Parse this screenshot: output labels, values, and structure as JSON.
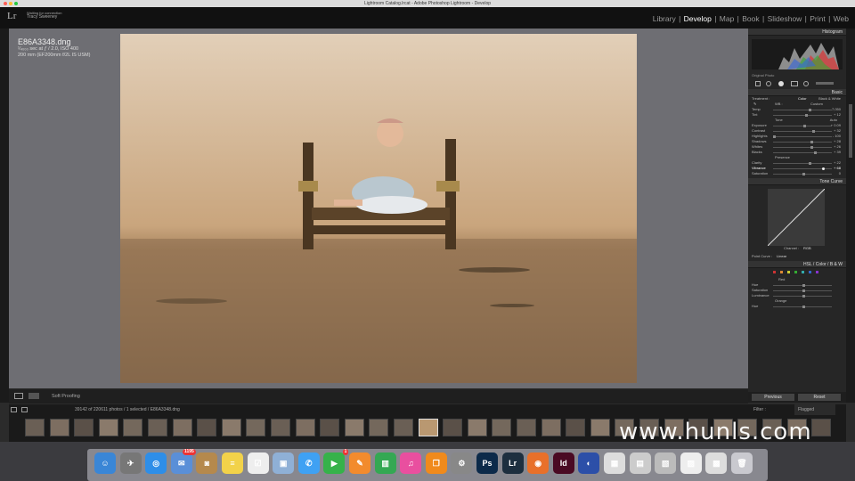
{
  "window": {
    "title": "Lightroom Catalog.lrcat - Adobe Photoshop Lightroom - Develop"
  },
  "header": {
    "logo": "Lr",
    "owner_line1": "Waiting for connection",
    "owner_line2": "Tracy Sweeney"
  },
  "modules": [
    {
      "label": "Library"
    },
    {
      "label": "Develop"
    },
    {
      "label": "Map"
    },
    {
      "label": "Book"
    },
    {
      "label": "Slideshow"
    },
    {
      "label": "Print"
    },
    {
      "label": "Web"
    }
  ],
  "active_module": "Develop",
  "photo_info": {
    "filename": "E86A3348.dng",
    "exposure": "¹⁄₄₀₀₀ sec at ƒ / 2.0, ISO 400",
    "lens": "200 mm (EF200mm f/2L IS USM)"
  },
  "toolbar": {
    "soft_proofing": "Soft Proofing"
  },
  "panel": {
    "histogram_title": "Histogram",
    "original_photo": "Original Photo",
    "basic_title": "Basic",
    "treatment_label": "Treatment :",
    "treatment_color": "Color",
    "treatment_bw": "Black & White",
    "wb_label": "WB :",
    "wb_value": "Custom",
    "tone_label": "Tone",
    "tone_auto": "Auto",
    "presence_label": "Presence",
    "tone_curve_title": "Tone Curve",
    "channel_label": "Channel :",
    "channel_value": "RGB",
    "point_curve_label": "Point Curve :",
    "point_curve_value": "Linear",
    "hsl_tabs": "HSL  /  Color  /  B & W",
    "red_label": "Red",
    "orange_label": "Orange",
    "previous_button": "Previous",
    "reset_button": "Reset",
    "sliders": [
      {
        "label": "Temp",
        "value": "7,050"
      },
      {
        "label": "Tint",
        "value": "+ 12"
      },
      {
        "label": "Exposure",
        "value": "+ 0.09"
      },
      {
        "label": "Contrast",
        "value": "+ 32"
      },
      {
        "label": "Highlights",
        "value": "- 100"
      },
      {
        "label": "Shadows",
        "value": "+ 28"
      },
      {
        "label": "Whites",
        "value": "+ 26"
      },
      {
        "label": "Blacks",
        "value": "+ 39"
      },
      {
        "label": "Clarity",
        "value": "+ 22"
      },
      {
        "label": "Vibrance",
        "value": "+ 68"
      },
      {
        "label": "Saturation",
        "value": "0"
      }
    ],
    "hsl_sliders": [
      {
        "label": "Hue"
      },
      {
        "label": "Saturation"
      },
      {
        "label": "Luminance"
      },
      {
        "label": "Hue"
      }
    ]
  },
  "filmbar": {
    "info": "39142 of 220611 photos / 1 selected / E86A3348.dng",
    "filter_label": "Filter :",
    "filter_value": "Flagged"
  },
  "watermark": "www.hunls.com",
  "dock": [
    {
      "name": "finder-icon",
      "color": "#3a86d6",
      "glyph": "☺"
    },
    {
      "name": "launchpad-icon",
      "color": "#777",
      "glyph": "✈"
    },
    {
      "name": "safari-icon",
      "color": "#2e8ee8",
      "glyph": "◎"
    },
    {
      "name": "mail-icon",
      "color": "#5a8fd8",
      "glyph": "✉",
      "badge": "1195"
    },
    {
      "name": "contacts-icon",
      "color": "#b5894d",
      "glyph": "◙"
    },
    {
      "name": "notes-icon",
      "color": "#f2d24a",
      "glyph": "≡"
    },
    {
      "name": "reminders-icon",
      "color": "#eee",
      "glyph": "☑"
    },
    {
      "name": "preview-icon",
      "color": "#8fb0d6",
      "glyph": "▣"
    },
    {
      "name": "messages-icon",
      "color": "#3fa1f3",
      "glyph": "✆"
    },
    {
      "name": "facetime-icon",
      "color": "#36b24a",
      "glyph": "▶",
      "badge": "1"
    },
    {
      "name": "pages-icon",
      "color": "#f28b2d",
      "glyph": "✎"
    },
    {
      "name": "numbers-icon",
      "color": "#34a853",
      "glyph": "▥"
    },
    {
      "name": "itunes-icon",
      "color": "#e94f9f",
      "glyph": "♫"
    },
    {
      "name": "ibooks-icon",
      "color": "#f08a1c",
      "glyph": "❒"
    },
    {
      "name": "system-preferences-icon",
      "color": "#888",
      "glyph": "⚙"
    },
    {
      "name": "photoshop-icon",
      "color": "#0c2a4a",
      "glyph": "Ps"
    },
    {
      "name": "lightroom-icon",
      "color": "#1d2f3f",
      "glyph": "Lr"
    },
    {
      "name": "firefox-icon",
      "color": "#e8702a",
      "glyph": "◉"
    },
    {
      "name": "indesign-icon",
      "color": "#4a0a23",
      "glyph": "Id"
    },
    {
      "name": "photo-booth-icon",
      "color": "#2c4fa8",
      "glyph": "◐"
    },
    {
      "name": "downloads-folder-icon",
      "color": "#ddd",
      "glyph": "▦"
    },
    {
      "name": "documents-folder-icon",
      "color": "#ccc",
      "glyph": "▤"
    },
    {
      "name": "stack-icon",
      "color": "#bbb",
      "glyph": "▧"
    },
    {
      "name": "recent-docs-icon",
      "color": "#eee",
      "glyph": "▨"
    },
    {
      "name": "files-icon",
      "color": "#ddd",
      "glyph": "▩"
    },
    {
      "name": "trash-icon",
      "color": "#c9c9cf",
      "glyph": "🗑"
    }
  ]
}
